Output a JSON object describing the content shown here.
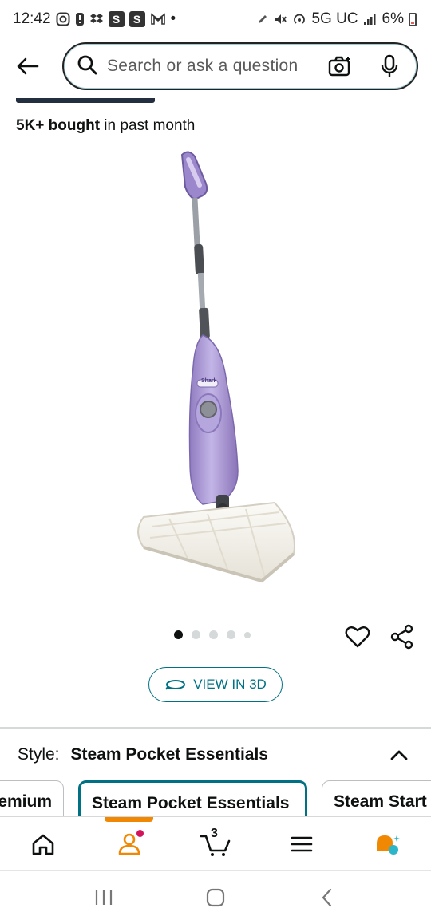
{
  "status_bar": {
    "time": "12:42",
    "left_icons": [
      "instagram-icon",
      "notification-icon",
      "dropbox-icon",
      "s-app-icon",
      "s-app-icon",
      "gmail-icon",
      "dot-icon"
    ],
    "network": "5G UC",
    "battery": "6%",
    "sb_s1": "S",
    "sb_s2": "S",
    "sb_dot": "•"
  },
  "search": {
    "placeholder": "Search or ask a question"
  },
  "product": {
    "bought_bold": "5K+ bought",
    "bought_rest": " in past month",
    "image_alt": "Shark steam mop, lavender",
    "brand_badge": "Shark",
    "carousel_count": 5,
    "carousel_active_index": 0
  },
  "view3d": {
    "label": "VIEW IN 3D"
  },
  "style": {
    "label": "Style:",
    "selected": "Steam Pocket Essentials",
    "options": [
      "emium",
      "Steam Pocket Essentials",
      "Steam Start"
    ]
  },
  "bottom_nav": {
    "items": [
      "home-icon",
      "account-icon",
      "cart-icon",
      "menu-icon",
      "rufus-icon"
    ],
    "active": "account-icon",
    "cart_count": "3"
  },
  "colors": {
    "accent": "#007185",
    "active_nav": "#f08804",
    "dark": "#232f3e",
    "mop_purple": "#a890d0"
  }
}
